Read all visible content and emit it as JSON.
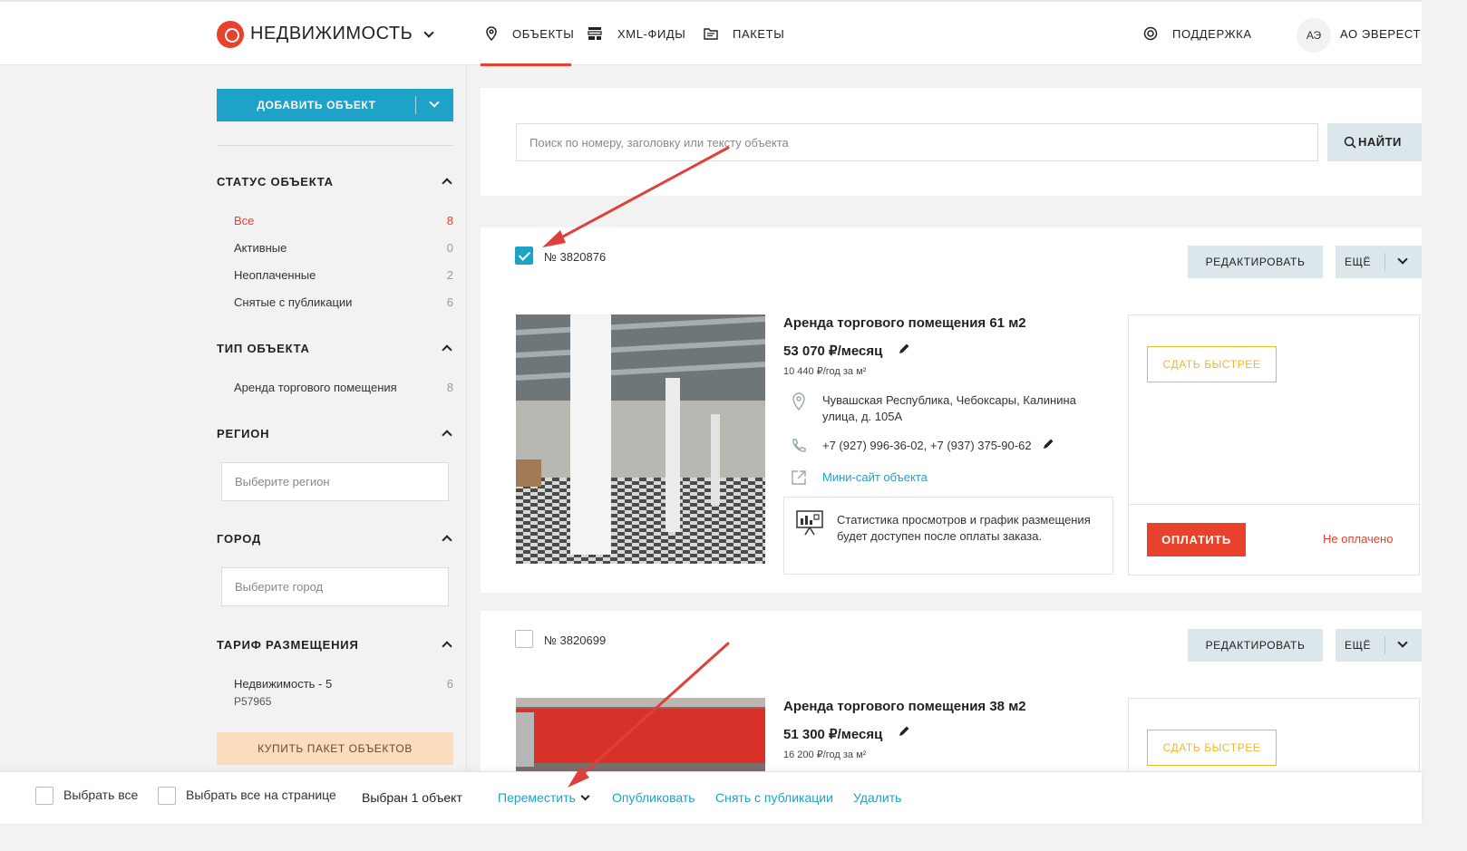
{
  "header": {
    "logo_text": "НЕДВИЖИМОСТЬ",
    "nav": [
      {
        "label": "ОБЪЕКТЫ",
        "icon": "map-pin-icon",
        "active": true
      },
      {
        "label": "XML-ФИДЫ",
        "icon": "feed-icon"
      },
      {
        "label": "ПАКЕТЫ",
        "icon": "folder-icon"
      }
    ],
    "support_label": "ПОДДЕРЖКА",
    "avatar_initials": "АЭ",
    "user_name": "АО ЭВЕРЕСТ"
  },
  "sidebar": {
    "add_button": "ДОБАВИТЬ ОБЪЕКТ",
    "status": {
      "title": "СТАТУС ОБЪЕКТА",
      "items": [
        {
          "label": "Все",
          "count": "8"
        },
        {
          "label": "Активные",
          "count": "0"
        },
        {
          "label": "Неоплаченные",
          "count": "2"
        },
        {
          "label": "Снятые с публикации",
          "count": "6"
        }
      ]
    },
    "type": {
      "title": "ТИП ОБЪЕКТА",
      "items": [
        {
          "label": "Аренда торгового помещения",
          "count": "8"
        }
      ]
    },
    "region": {
      "title": "РЕГИОН",
      "placeholder": "Выберите регион"
    },
    "city": {
      "title": "ГОРОД",
      "placeholder": "Выберите город"
    },
    "tariff": {
      "title": "ТАРИФ РАЗМЕЩЕНИЯ",
      "item_line1": "Недвижимость - 5",
      "item_line2": "P57965",
      "count": "6"
    },
    "buy_button": "КУПИТЬ ПАКЕТ ОБЪЕКТОВ"
  },
  "search": {
    "placeholder": "Поиск по номеру, заголовку или тексту объекта",
    "button": "НАЙТИ"
  },
  "listings": [
    {
      "number": "№ 3820876",
      "checked": true,
      "edit_label": "РЕДАКТИРОВАТЬ",
      "more_label": "ЕЩЁ",
      "title": "Аренда торгового помещения 61 м2",
      "price": "53 070 ₽/месяц",
      "price_per_m": "10 440 ₽/год за м²",
      "address": "Чувашская Республика, Чебоксары, Калинина улица, д. 105А",
      "phones": "+7 (927) 996-36-02, +7 (937) 375-90-62",
      "minisite": "Мини-сайт объекта",
      "stats_note": "Статистика просмотров и график размещения будет доступен после оплаты заказа.",
      "fast_label": "СДАТЬ БЫСТРЕЕ",
      "pay_label": "ОПЛАТИТЬ",
      "status": "Не оплачено"
    },
    {
      "number": "№ 3820699",
      "checked": false,
      "edit_label": "РЕДАКТИРОВАТЬ",
      "more_label": "ЕЩЁ",
      "title": "Аренда торгового помещения 38 м2",
      "price": "51 300 ₽/месяц",
      "price_per_m": "16 200 ₽/год за м²",
      "fast_label": "СДАТЬ БЫСТРЕЕ"
    }
  ],
  "bottom_bar": {
    "select_all": "Выбрать все",
    "select_page": "Выбрать все на странице",
    "selected_count": "Выбран 1 объект",
    "actions": [
      "Переместить",
      "Опубликовать",
      "Снять с публикации",
      "Удалить"
    ]
  },
  "colors": {
    "accent": "#1ea2c7",
    "brand_red": "#e8412c",
    "fast_yellow": "#f1b928",
    "arrow": "#e0403a"
  }
}
